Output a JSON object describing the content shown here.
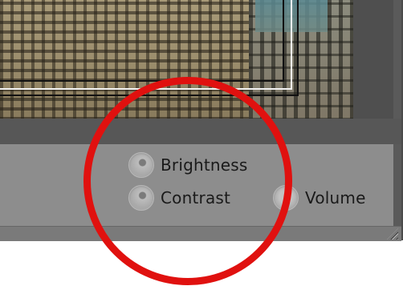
{
  "controls": {
    "brightness": {
      "label": "Brightness",
      "selected": false
    },
    "contrast": {
      "label": "Contrast",
      "selected": false
    },
    "volume": {
      "label": "Volume",
      "selected": false
    }
  },
  "colors": {
    "annotation_circle": "#e0110f",
    "panel_background": "#8d8d8d",
    "viewer_background": "#575757"
  },
  "icons": [
    "resize-grip-icon"
  ]
}
